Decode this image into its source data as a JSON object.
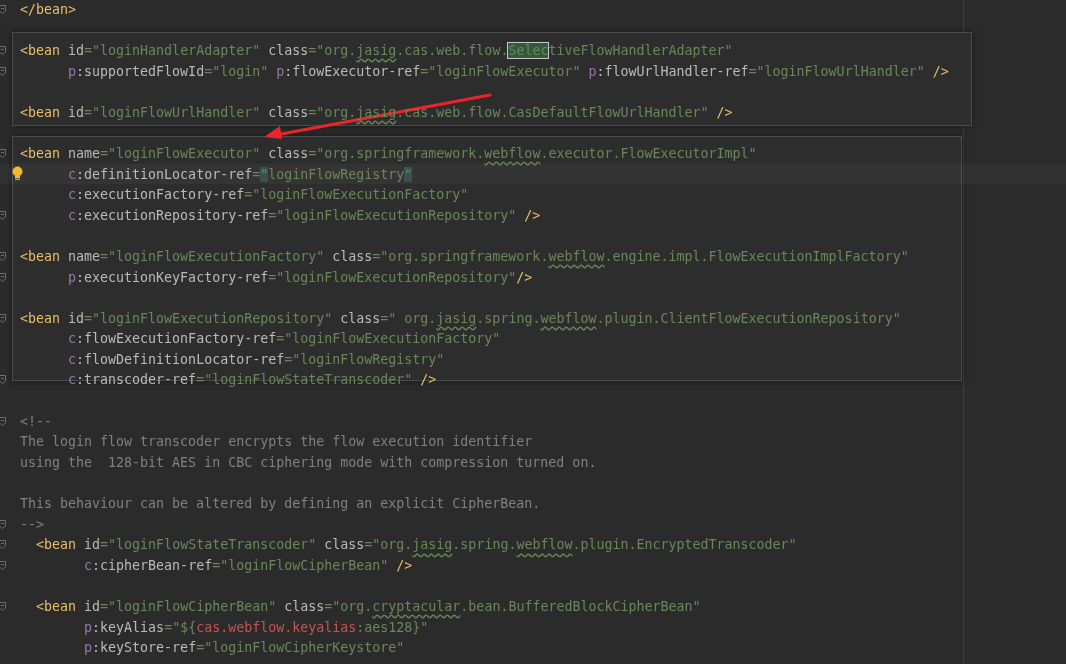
{
  "editor": {
    "lines": [
      {
        "kind": "code",
        "fold": true,
        "tokens": [
          {
            "kind": "tag",
            "text": "</bean>"
          }
        ]
      },
      {
        "kind": "blank"
      },
      {
        "kind": "code",
        "fold": true,
        "tokens": [
          {
            "kind": "tag",
            "text": "<bean"
          },
          {
            "kind": "attr",
            "text": " id"
          },
          {
            "kind": "str",
            "text": "=\"loginHandlerAdapter\""
          },
          {
            "kind": "attr",
            "text": " class"
          },
          {
            "kind": "str",
            "text": "=\"org."
          },
          {
            "kind": "typo",
            "text": "jasig"
          },
          {
            "kind": "str",
            "text": ".cas.web.flow."
          },
          {
            "kind": "match",
            "text": "Selec"
          },
          {
            "kind": "str",
            "text": "tiveFlowHandlerAdapter\""
          }
        ]
      },
      {
        "kind": "code",
        "fold": true,
        "tokens": [
          {
            "kind": "ns",
            "text": "      p"
          },
          {
            "kind": "attr",
            "text": ":supportedFlowId"
          },
          {
            "kind": "str",
            "text": "=\"login\" "
          },
          {
            "kind": "ns",
            "text": "p"
          },
          {
            "kind": "attr",
            "text": ":flowExecutor-ref"
          },
          {
            "kind": "str",
            "text": "=\"loginFlowExecutor\" "
          },
          {
            "kind": "ns",
            "text": "p"
          },
          {
            "kind": "attr",
            "text": ":flowUrlHandler-ref"
          },
          {
            "kind": "str",
            "text": "=\"loginFlowUrlHandler\""
          },
          {
            "kind": "tag",
            "text": " />"
          }
        ]
      },
      {
        "kind": "blank"
      },
      {
        "kind": "code",
        "tokens": [
          {
            "kind": "tag",
            "text": "<bean"
          },
          {
            "kind": "attr",
            "text": " id"
          },
          {
            "kind": "str",
            "text": "=\"loginFlowUrlHandler\""
          },
          {
            "kind": "attr",
            "text": " class"
          },
          {
            "kind": "str",
            "text": "=\"org."
          },
          {
            "kind": "typo",
            "text": "jasig"
          },
          {
            "kind": "str",
            "text": ".cas.web.flow.CasDefaultFlowUrlHandler\""
          },
          {
            "kind": "tag",
            "text": " />"
          }
        ]
      },
      {
        "kind": "blank"
      },
      {
        "kind": "code",
        "fold": true,
        "tokens": [
          {
            "kind": "tag",
            "text": "<bean"
          },
          {
            "kind": "attr",
            "text": " name"
          },
          {
            "kind": "str",
            "text": "=\"loginFlowExecutor\""
          },
          {
            "kind": "attr",
            "text": " class"
          },
          {
            "kind": "str",
            "text": "=\"org.springframework."
          },
          {
            "kind": "typo",
            "text": "webflow"
          },
          {
            "kind": "str",
            "text": ".executor.FlowExecutorImpl\""
          }
        ]
      },
      {
        "kind": "code",
        "current": true,
        "hint": true,
        "tokens": [
          {
            "kind": "ns",
            "text": "      c"
          },
          {
            "kind": "attr",
            "text": ":definitionLocator-ref"
          },
          {
            "kind": "str",
            "text": "="
          },
          {
            "kind": "brace",
            "text": "\""
          },
          {
            "kind": "str",
            "text": "loginFlowRegistry"
          },
          {
            "kind": "brace",
            "text": "\""
          }
        ]
      },
      {
        "kind": "code",
        "tokens": [
          {
            "kind": "ns",
            "text": "      c"
          },
          {
            "kind": "attr",
            "text": ":executionFactory-ref"
          },
          {
            "kind": "str",
            "text": "=\"loginFlowExecutionFactory\""
          }
        ]
      },
      {
        "kind": "code",
        "fold": true,
        "tokens": [
          {
            "kind": "ns",
            "text": "      c"
          },
          {
            "kind": "attr",
            "text": ":executionRepository-ref"
          },
          {
            "kind": "str",
            "text": "=\"loginFlowExecutionRepository\""
          },
          {
            "kind": "tag",
            "text": " />"
          }
        ]
      },
      {
        "kind": "blank"
      },
      {
        "kind": "code",
        "fold": true,
        "tokens": [
          {
            "kind": "tag",
            "text": "<bean"
          },
          {
            "kind": "attr",
            "text": " name"
          },
          {
            "kind": "str",
            "text": "=\"loginFlowExecutionFactory\""
          },
          {
            "kind": "attr",
            "text": " class"
          },
          {
            "kind": "str",
            "text": "=\"org.springframework."
          },
          {
            "kind": "typo",
            "text": "webflow"
          },
          {
            "kind": "str",
            "text": ".engine.impl.FlowExecutionImplFactory\""
          }
        ]
      },
      {
        "kind": "code",
        "fold": true,
        "tokens": [
          {
            "kind": "ns",
            "text": "      p"
          },
          {
            "kind": "attr",
            "text": ":executionKeyFactory-ref"
          },
          {
            "kind": "str",
            "text": "=\"loginFlowExecutionRepository\""
          },
          {
            "kind": "tag",
            "text": "/>"
          }
        ]
      },
      {
        "kind": "blank"
      },
      {
        "kind": "code",
        "fold": true,
        "tokens": [
          {
            "kind": "tag",
            "text": "<bean"
          },
          {
            "kind": "attr",
            "text": " id"
          },
          {
            "kind": "str",
            "text": "=\"loginFlowExecutionRepository\""
          },
          {
            "kind": "attr",
            "text": " class"
          },
          {
            "kind": "str",
            "text": "=\" org."
          },
          {
            "kind": "typo",
            "text": "jasig"
          },
          {
            "kind": "str",
            "text": ".spring."
          },
          {
            "kind": "typo",
            "text": "webflow"
          },
          {
            "kind": "str",
            "text": ".plugin.ClientFlowExecutionRepository\""
          }
        ]
      },
      {
        "kind": "code",
        "tokens": [
          {
            "kind": "ns",
            "text": "      c"
          },
          {
            "kind": "attr",
            "text": ":flowExecutionFactory-ref"
          },
          {
            "kind": "str",
            "text": "=\"loginFlowExecutionFactory\""
          }
        ]
      },
      {
        "kind": "code",
        "tokens": [
          {
            "kind": "ns",
            "text": "      c"
          },
          {
            "kind": "attr",
            "text": ":flowDefinitionLocator-ref"
          },
          {
            "kind": "str",
            "text": "=\"loginFlowRegistry\""
          }
        ]
      },
      {
        "kind": "code",
        "fold": true,
        "tokens": [
          {
            "kind": "ns",
            "text": "      c"
          },
          {
            "kind": "attr",
            "text": ":transcoder-ref"
          },
          {
            "kind": "str",
            "text": "=\"loginFlowStateTranscoder\""
          },
          {
            "kind": "tag",
            "text": " />"
          }
        ]
      },
      {
        "kind": "blank"
      },
      {
        "kind": "code",
        "fold": true,
        "tokens": [
          {
            "kind": "comment",
            "text": "<!--"
          }
        ]
      },
      {
        "kind": "code",
        "tokens": [
          {
            "kind": "comment",
            "text": "The login flow transcoder encrypts the flow execution identifier"
          }
        ]
      },
      {
        "kind": "code",
        "tokens": [
          {
            "kind": "comment",
            "text": "using the  128-bit AES in CBC ciphering mode with compression turned on."
          }
        ]
      },
      {
        "kind": "blank"
      },
      {
        "kind": "code",
        "tokens": [
          {
            "kind": "comment",
            "text": "This behaviour can be altered by defining an explicit CipherBean."
          }
        ]
      },
      {
        "kind": "code",
        "fold": true,
        "tokens": [
          {
            "kind": "comment",
            "text": "-->"
          }
        ]
      },
      {
        "kind": "code",
        "fold": true,
        "tokens": [
          {
            "kind": "tag",
            "text": "  <bean"
          },
          {
            "kind": "attr",
            "text": " id"
          },
          {
            "kind": "str",
            "text": "=\"loginFlowStateTranscoder\""
          },
          {
            "kind": "attr",
            "text": " class"
          },
          {
            "kind": "str",
            "text": "=\"org."
          },
          {
            "kind": "typo",
            "text": "jasig"
          },
          {
            "kind": "str",
            "text": ".spring."
          },
          {
            "kind": "typo",
            "text": "webflow"
          },
          {
            "kind": "str",
            "text": ".plugin.EncryptedTranscoder\""
          }
        ]
      },
      {
        "kind": "code",
        "fold": true,
        "tokens": [
          {
            "kind": "ns",
            "text": "        c"
          },
          {
            "kind": "attr",
            "text": ":cipherBean-ref"
          },
          {
            "kind": "str",
            "text": "=\"loginFlowCipherBean\""
          },
          {
            "kind": "tag",
            "text": " />"
          }
        ]
      },
      {
        "kind": "blank"
      },
      {
        "kind": "code",
        "fold": true,
        "tokens": [
          {
            "kind": "tag",
            "text": "  <bean"
          },
          {
            "kind": "attr",
            "text": " id"
          },
          {
            "kind": "str",
            "text": "=\"loginFlowCipherBean\""
          },
          {
            "kind": "attr",
            "text": " class"
          },
          {
            "kind": "str",
            "text": "=\"org."
          },
          {
            "kind": "typo",
            "text": "cryptacular"
          },
          {
            "kind": "str",
            "text": ".bean.BufferedBlockCipherBean\""
          }
        ]
      },
      {
        "kind": "code",
        "tokens": [
          {
            "kind": "ns",
            "text": "        p"
          },
          {
            "kind": "attr",
            "text": ":keyAlias"
          },
          {
            "kind": "str",
            "text": "=\"${"
          },
          {
            "kind": "expr",
            "text": "cas.webflow.keyalias"
          },
          {
            "kind": "str",
            "text": ":aes128}\""
          }
        ]
      },
      {
        "kind": "code",
        "tokens": [
          {
            "kind": "ns",
            "text": "        p"
          },
          {
            "kind": "attr",
            "text": ":keyStore-ref"
          },
          {
            "kind": "str",
            "text": "=\"loginFlowCipherKeystore\""
          }
        ]
      }
    ]
  }
}
